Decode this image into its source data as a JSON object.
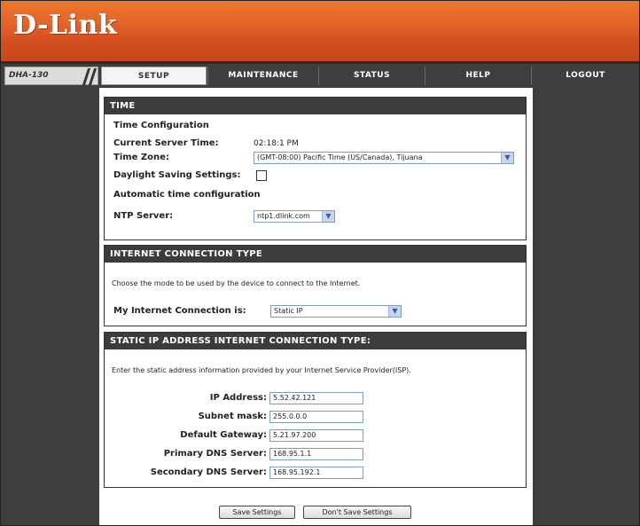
{
  "brand": {
    "logo": "D-Link"
  },
  "nav": {
    "model": "DHA-130",
    "tabs": [
      {
        "label": "SETUP"
      },
      {
        "label": "MAINTENANCE"
      },
      {
        "label": "STATUS"
      },
      {
        "label": "HELP"
      },
      {
        "label": "LOGOUT"
      }
    ]
  },
  "time": {
    "header": "TIME",
    "config_title": "Time Configuration",
    "server_time_label": "Current Server Time:",
    "server_time_value": "02:18:1 PM",
    "timezone_label": "Time Zone:",
    "timezone_value": "(GMT-08:00) Pacific Time (US/Canada), Tijuana",
    "dst_label": "Daylight Saving Settings:",
    "auto_title": "Automatic time configuration",
    "ntp_label": "NTP Server:",
    "ntp_value": "ntp1.dlink.com"
  },
  "internet": {
    "header": "INTERNET CONNECTION TYPE",
    "instruction": "Choose the mode to be used by the device to connect to the Internet.",
    "connection_label": "My Internet Connection is:",
    "connection_value": "Static IP"
  },
  "static_ip": {
    "header": "STATIC IP ADDRESS INTERNET CONNECTION TYPE:",
    "instruction": "Enter the static address information provided by your Internet Service Provider(ISP).",
    "fields": [
      {
        "label": "IP Address:",
        "value": "5.52.42.121"
      },
      {
        "label": "Subnet mask:",
        "value": "255.0.0.0"
      },
      {
        "label": "Default Gateway:",
        "value": "5.21.97.200"
      },
      {
        "label": "Primary DNS Server:",
        "value": "168.95.1.1"
      },
      {
        "label": "Secondary DNS Server:",
        "value": "168.95.192.1"
      }
    ]
  },
  "buttons": {
    "save": "Save Settings",
    "dont_save": "Don't Save Settings"
  }
}
